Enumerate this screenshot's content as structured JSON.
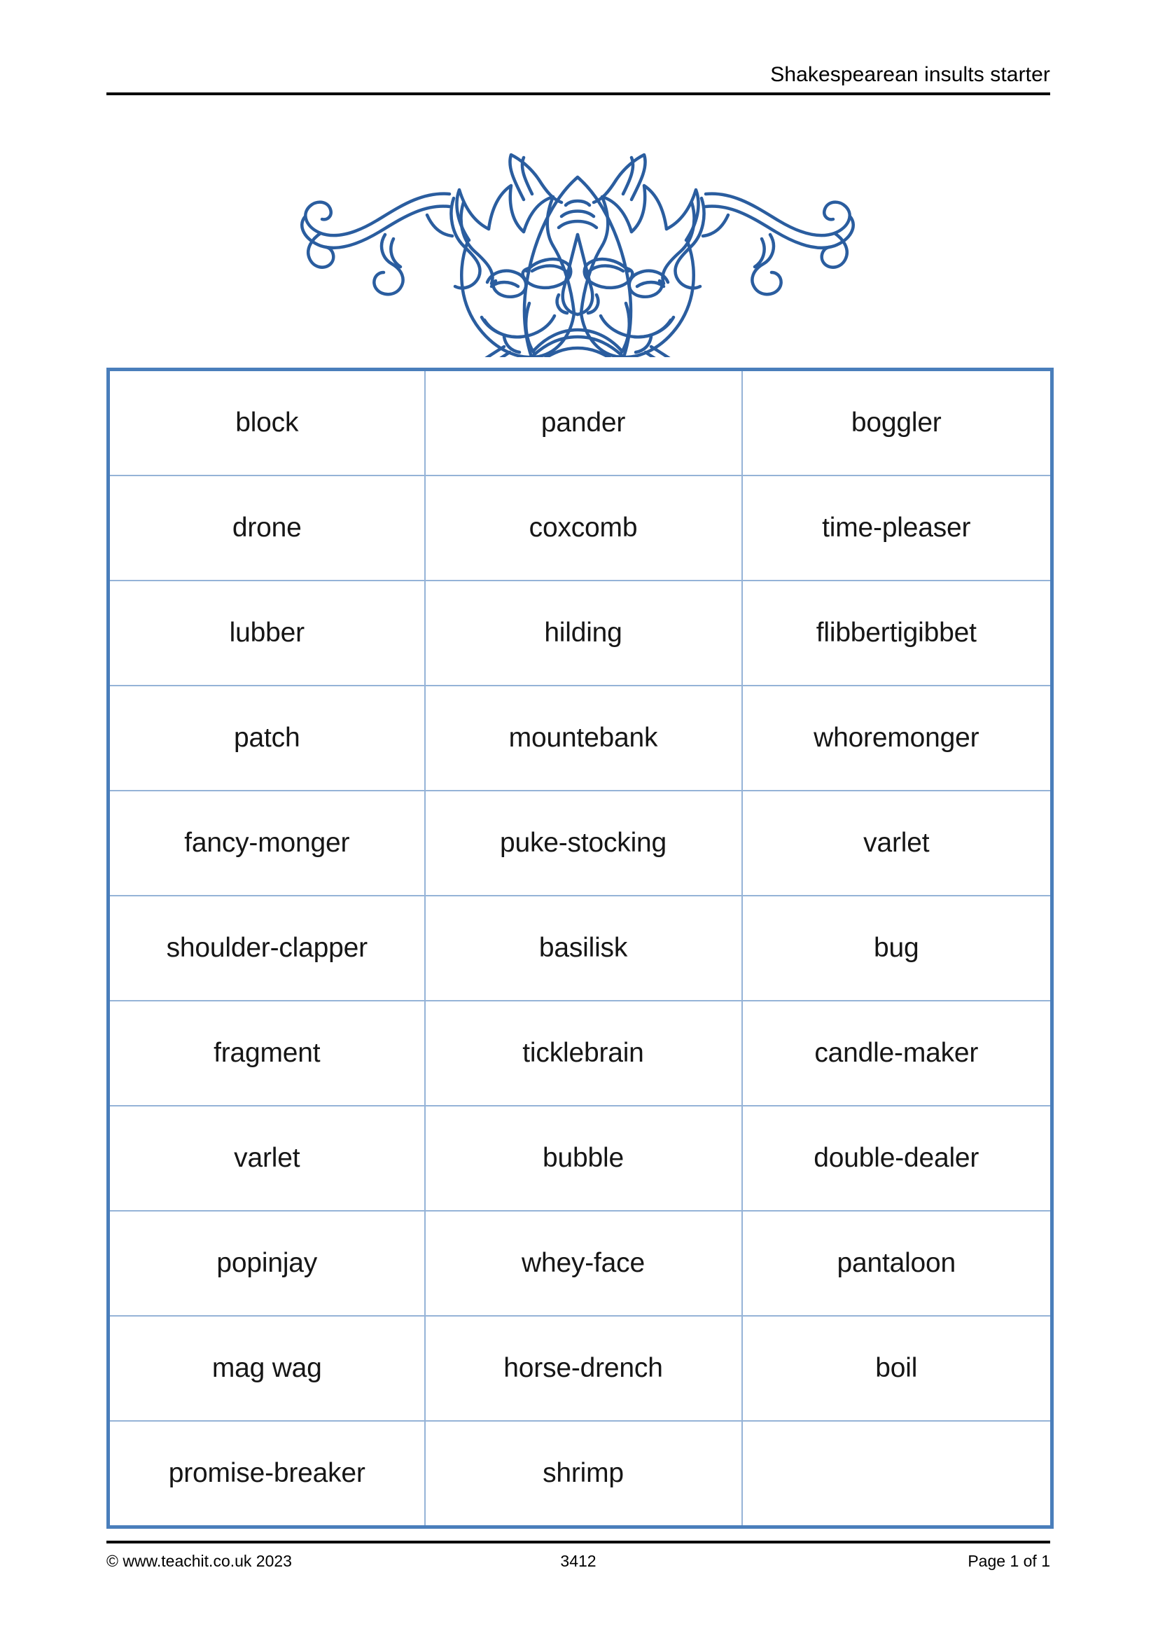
{
  "document": {
    "header_title": "Shakespearean insults starter",
    "illustration": {
      "name": "shakespearean-masks-ornament",
      "description": "Blue line-art decorative ornament of three theatrical jester masks with flowing ribbons and bells",
      "stroke_color": "#2a5d9f"
    },
    "colors": {
      "table_outer_border": "#4a7ebb",
      "table_inner_border": "#95b3d7",
      "rule_color": "#000000",
      "text_color": "#161616"
    }
  },
  "table": {
    "columns": 3,
    "rows": [
      [
        "block",
        "pander",
        "boggler"
      ],
      [
        "drone",
        "coxcomb",
        "time-pleaser"
      ],
      [
        "lubber",
        "hilding",
        "flibbertigibbet"
      ],
      [
        "patch",
        "mountebank",
        "whoremonger"
      ],
      [
        "fancy-monger",
        "puke-stocking",
        "varlet"
      ],
      [
        "shoulder-clapper",
        "basilisk",
        "bug"
      ],
      [
        "fragment",
        "ticklebrain",
        "candle-maker"
      ],
      [
        "varlet",
        "bubble",
        "double-dealer"
      ],
      [
        "popinjay",
        "whey-face",
        "pantaloon"
      ],
      [
        "mag wag",
        "horse-drench",
        "boil"
      ],
      [
        "promise-breaker",
        "shrimp",
        ""
      ]
    ]
  },
  "footer": {
    "copyright": "© www.teachit.co.uk 2023",
    "reference": "3412",
    "page": "Page 1 of 1"
  }
}
